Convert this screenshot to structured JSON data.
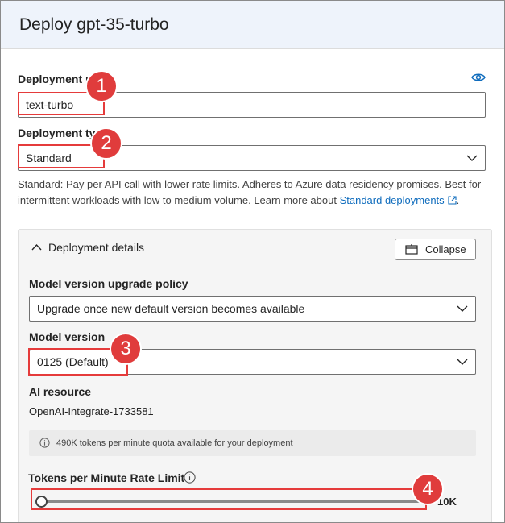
{
  "header": {
    "title": "Deploy gpt-35-turbo"
  },
  "deployment_name": {
    "label": "Deployment name",
    "value": "text-turbo",
    "icon": "eye-icon"
  },
  "deployment_type": {
    "label": "Deployment type",
    "value": "Standard",
    "help_text": "Standard: Pay per API call with lower rate limits. Adheres to Azure data residency promises. Best for intermittent workloads with low to medium volume. Learn more about ",
    "link_text": "Standard deployments"
  },
  "details": {
    "title": "Deployment details",
    "collapse_label": "Collapse",
    "upgrade_policy": {
      "label": "Model version upgrade policy",
      "value": "Upgrade once new default version becomes available"
    },
    "model_version": {
      "label": "Model version",
      "value": "0125 (Default)"
    },
    "ai_resource": {
      "label": "AI resource",
      "value": "OpenAI-Integrate-1733581"
    },
    "quota_info": "490K tokens per minute quota available for your deployment",
    "rate_limit": {
      "label": "Tokens per Minute Rate Limit",
      "max_label": "10K",
      "slider_fraction": 0.0
    }
  },
  "annotations": [
    "1",
    "2",
    "3",
    "4"
  ],
  "colors": {
    "accent": "#0f6cbd",
    "annotation": "#e03c3c",
    "header_bg": "#eef3fb"
  }
}
